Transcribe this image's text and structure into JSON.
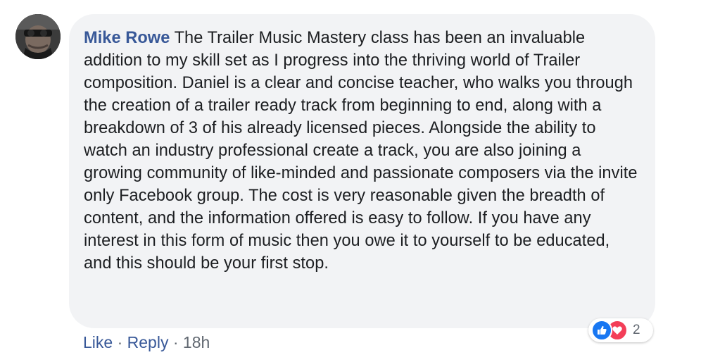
{
  "comment": {
    "author": "Mike Rowe",
    "text": "The Trailer Music Mastery class has been an invaluable addition to my skill set as I progress into the thriving world of Trailer composition. Daniel is a clear and concise teacher, who walks you through the creation of a trailer ready track from beginning to end, along with a breakdown of 3 of his already licensed pieces. Alongside the ability to watch an industry professional create a track, you are also joining a growing community of like-minded and passionate composers via the invite only Facebook group. The cost is very reasonable given the breadth of content, and the information offered is easy to follow. If you have any interest in this form of music then you owe it to yourself to be educated, and this should be your first stop."
  },
  "reactions": {
    "icons": [
      "like-icon",
      "love-icon"
    ],
    "count": "2"
  },
  "actions": {
    "like_label": "Like",
    "separator": "·",
    "reply_label": "Reply",
    "timestamp": "18h"
  },
  "colors": {
    "author": "#385898",
    "bubble": "#f2f3f5",
    "like": "#1877f2",
    "love": "#f33e58",
    "meta": "#606770"
  }
}
